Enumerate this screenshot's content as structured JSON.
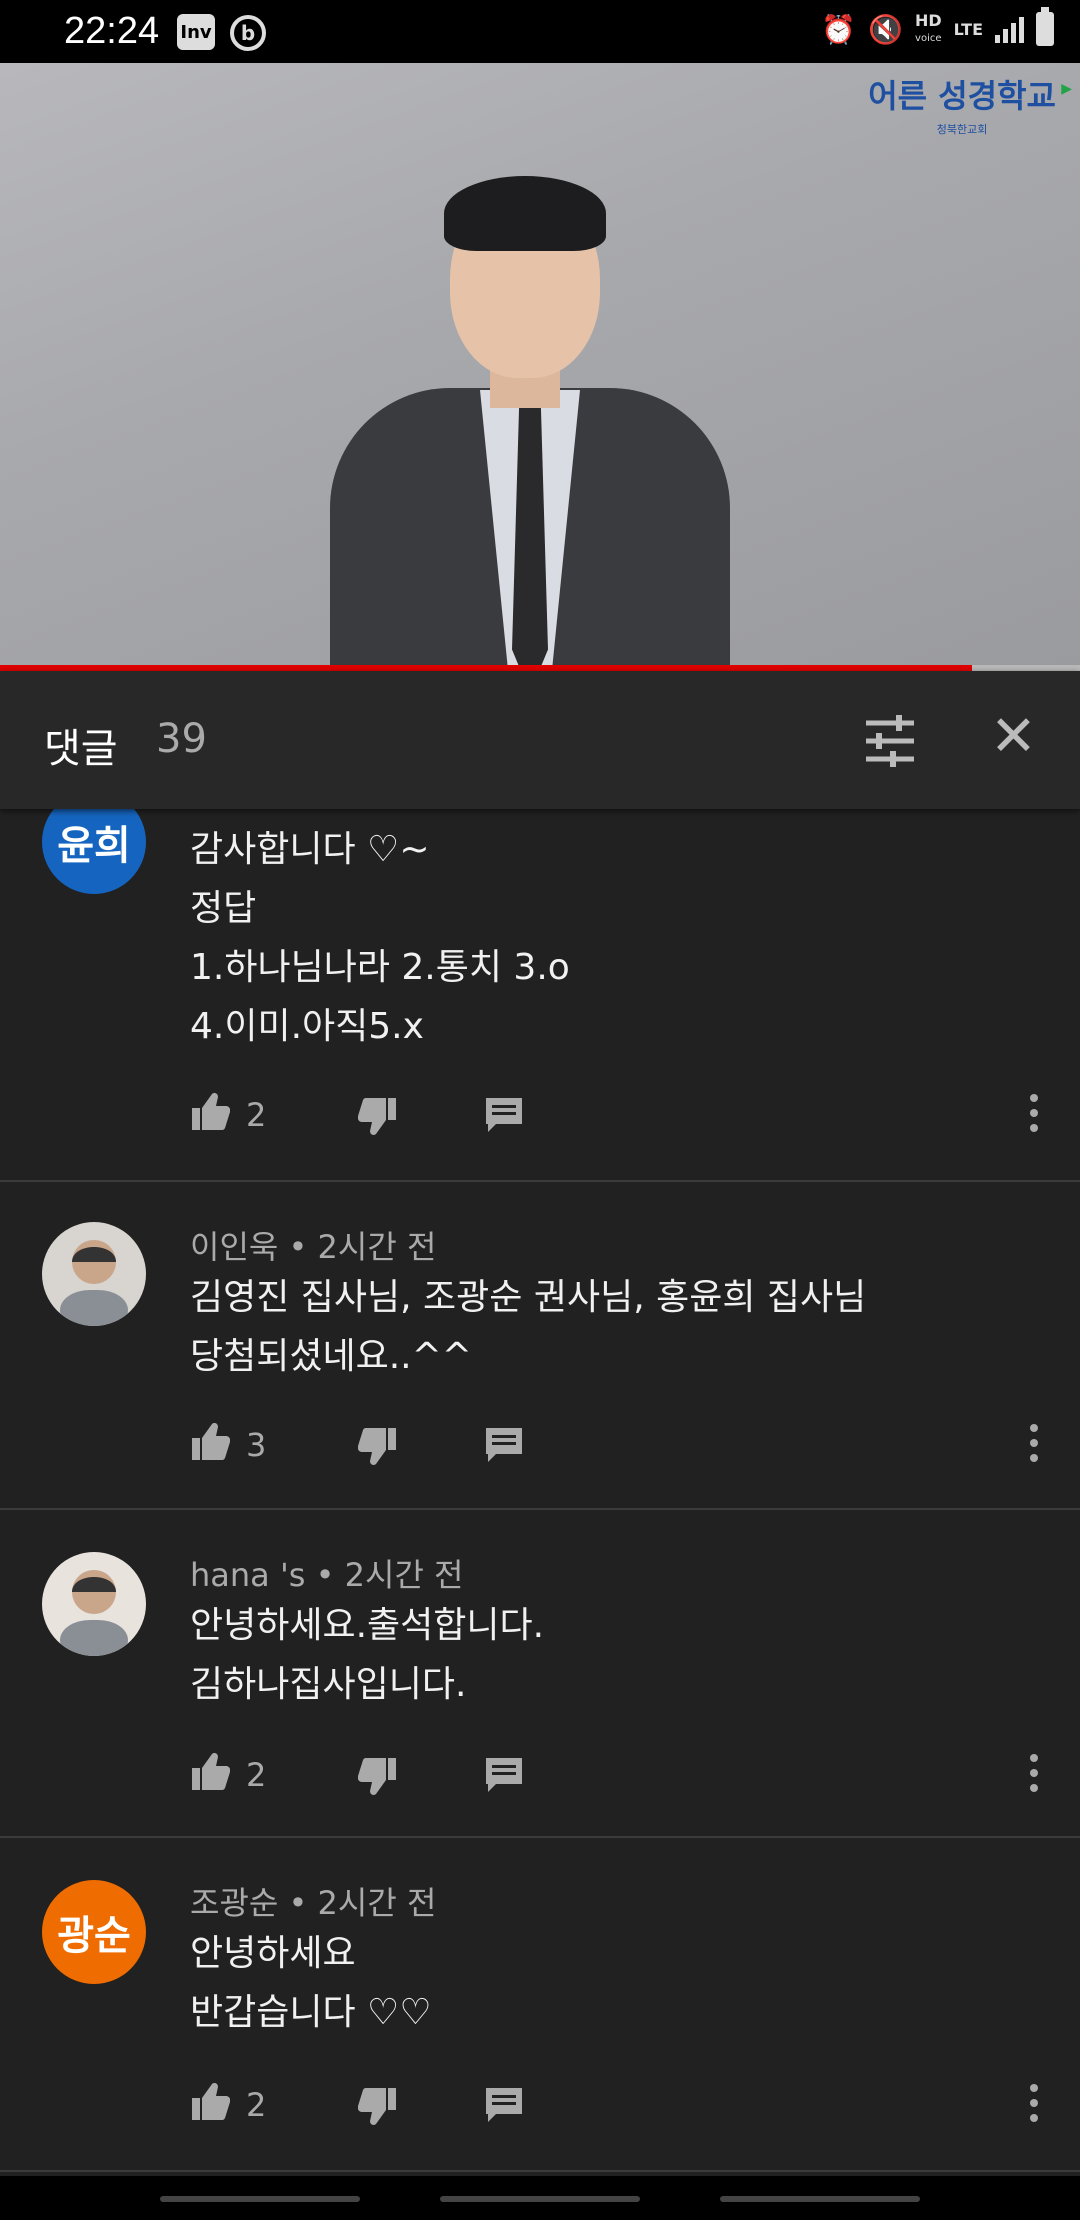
{
  "status_bar": {
    "time": "22:24",
    "app1": "Inv",
    "app2": "b",
    "hd": "HD",
    "voice": "voice",
    "lte": "LTE",
    "icons": [
      "alarm-icon",
      "vibrate-icon",
      "signal-icon",
      "battery-icon"
    ]
  },
  "video": {
    "logo_text": "어른 성경학교",
    "logo_subtext": "청북한교회",
    "progress_fraction": 0.9
  },
  "comments_panel": {
    "title": "댓글",
    "count": "39"
  },
  "comments": [
    {
      "avatar_text": "윤희",
      "avatar_color": "#1565c0",
      "author": "",
      "time": "",
      "lines": "감사합니다 ♡~\n정답\n1.하나님나라 2.통치 3.o\n4.이미.아직5.x",
      "likes": "2"
    },
    {
      "avatar_text": "",
      "avatar_color": "#d8d4cf",
      "author": "이인욱",
      "time": "2시간 전",
      "lines": "김영진 집사님, 조광순 권사님, 홍윤희 집사님\n당첨되셨네요..^^",
      "likes": "3"
    },
    {
      "avatar_text": "",
      "avatar_color": "#e9e3de",
      "author": "hana 's",
      "time": "2시간 전",
      "lines": "안녕하세요.출석합니다.\n김하나집사입니다.",
      "likes": "2"
    },
    {
      "avatar_text": "광순",
      "avatar_color": "#ef6c00",
      "author": "조광순",
      "time": "2시간 전",
      "lines": "안녕하세요\n반갑습니다 ♡♡",
      "likes": "2"
    }
  ],
  "colors": {
    "background": "#212121",
    "progress": "#e00000",
    "secondary_text": "#aaaaaa"
  }
}
